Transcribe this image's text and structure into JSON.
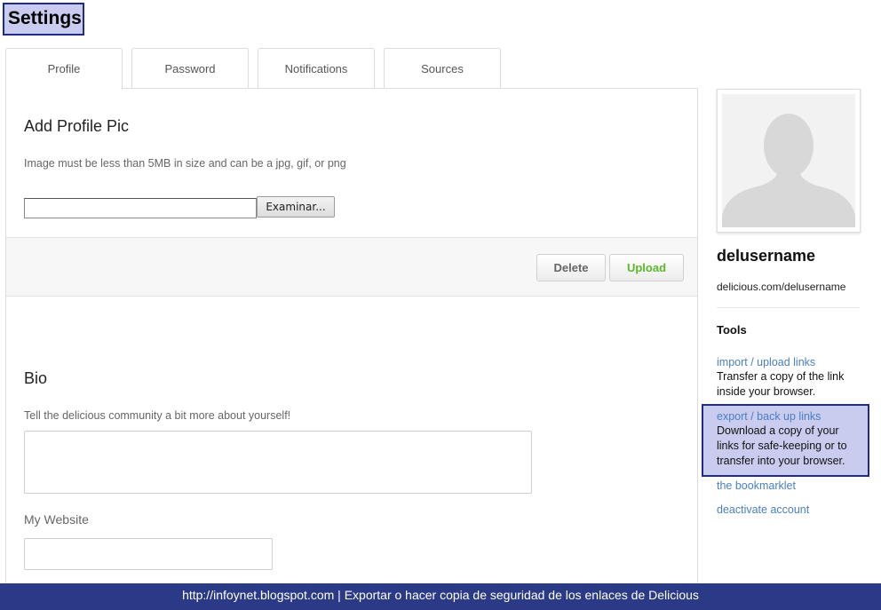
{
  "header": {
    "title": "Settings"
  },
  "tabs": [
    {
      "label": "Profile",
      "active": true
    },
    {
      "label": "Password",
      "active": false
    },
    {
      "label": "Notifications",
      "active": false
    },
    {
      "label": "Sources",
      "active": false
    }
  ],
  "profile_pic": {
    "title": "Add Profile Pic",
    "help": "Image must be less than 5MB in size and can be a jpg, gif, or png",
    "file_value": "",
    "browse_label": "Examinar...",
    "delete_label": "Delete",
    "upload_label": "Upload"
  },
  "bio": {
    "title": "Bio",
    "help": "Tell the delicious community a bit more about yourself!",
    "value": ""
  },
  "website": {
    "label": "My Website",
    "value": ""
  },
  "sidebar": {
    "username": "delusername",
    "profile_url": "delicious.com/delusername",
    "tools_heading": "Tools",
    "import_link": "import / upload links",
    "import_desc": "Transfer a copy of the link inside your browser.",
    "export_link": "export / back up links",
    "export_desc": "Download a copy of your links for safe-keeping or to transfer into your browser.",
    "bookmarklet_link": "the bookmarklet",
    "deactivate_link": "deactivate account"
  },
  "footer": {
    "text": "http://infoynet.blogspot.com | Exportar o hacer copia de seguridad de los enlaces de Delicious"
  },
  "colors": {
    "highlight_fill": "#c9ccef",
    "highlight_border": "#1f2a8a",
    "footer_bg": "#2b3a86",
    "link": "#4a7fc1",
    "upload_green": "#5bb82b"
  },
  "icons": {
    "avatar": "default-avatar-silhouette-icon"
  }
}
